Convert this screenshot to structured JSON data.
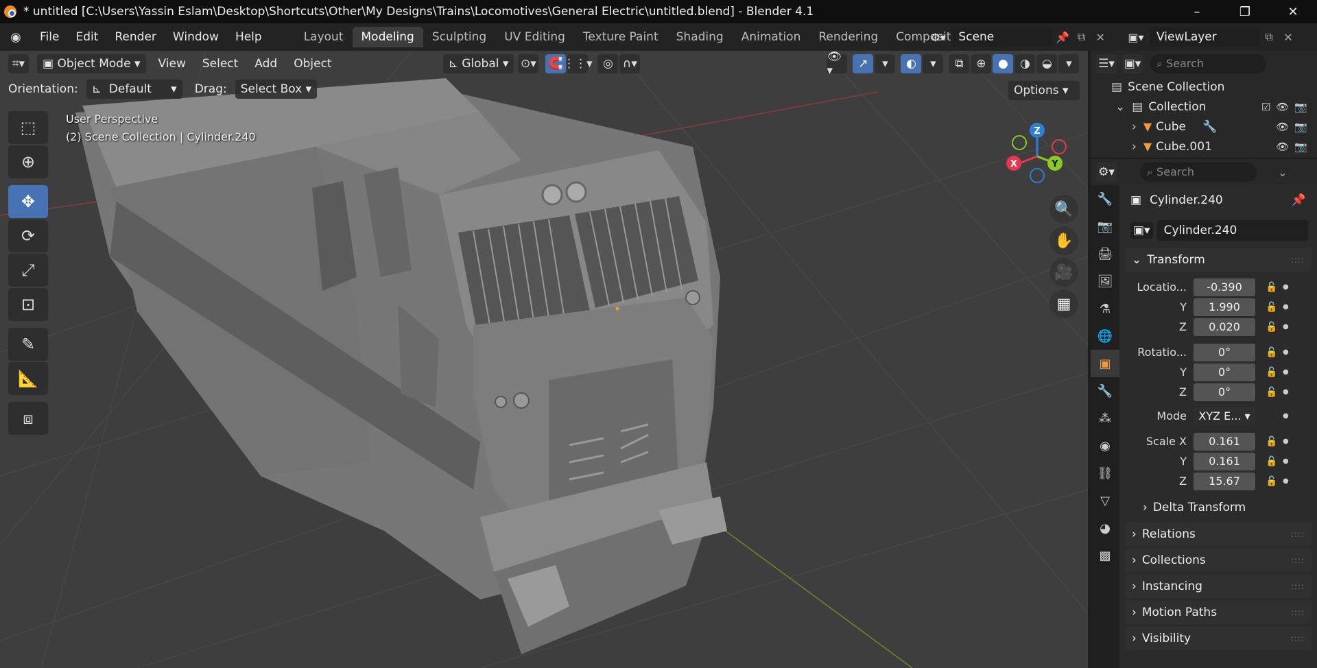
{
  "window": {
    "title": "* untitled [C:\\Users\\Yassin Eslam\\Desktop\\Shortcuts\\Other\\My Designs\\Trains\\Locomotives\\General Electric\\untitled.blend] - Blender 4.1",
    "minimize": "–",
    "maximize": "❐",
    "close": "✕"
  },
  "menu": {
    "items": [
      "File",
      "Edit",
      "Render",
      "Window",
      "Help"
    ],
    "workspaces": [
      "Layout",
      "Modeling",
      "Sculpting",
      "UV Editing",
      "Texture Paint",
      "Shading",
      "Animation",
      "Rendering",
      "Compositin"
    ],
    "active_workspace": "Modeling",
    "scene": "Scene",
    "view_layer": "ViewLayer"
  },
  "viewport": {
    "mode": "Object Mode",
    "menus": [
      "View",
      "Select",
      "Add",
      "Object"
    ],
    "transform_orientation": "Global",
    "orientation_label": "Orientation:",
    "orientation_value": "Default",
    "drag_label": "Drag:",
    "drag_value": "Select Box",
    "options_label": "Options",
    "perspective_text": "User Perspective",
    "collection_text": "(2) Scene Collection | Cylinder.240",
    "gizmo": {
      "x": "X",
      "y": "Y",
      "z": "Z"
    }
  },
  "tools": [
    "select-box",
    "cursor",
    "move",
    "rotate",
    "scale",
    "transform",
    "annotate",
    "measure",
    "add-cube"
  ],
  "outliner": {
    "search_placeholder": "Search",
    "rows": [
      {
        "label": "Scene Collection"
      },
      {
        "label": "Collection"
      },
      {
        "label": "Cube"
      },
      {
        "label": "Cube.001"
      }
    ]
  },
  "properties": {
    "search_placeholder": "Search",
    "object_name": "Cylinder.240",
    "data_name": "Cylinder.240",
    "transform_title": "Transform",
    "location": {
      "label": "Locatio...",
      "x": "-0.390",
      "y": "1.990",
      "z": "0.020"
    },
    "rotation": {
      "label": "Rotatio...",
      "x": "0°",
      "y": "0°",
      "z": "0°"
    },
    "mode_label": "Mode",
    "mode_value": "XYZ E...",
    "scale": {
      "label": "Scale X",
      "x": "0.161",
      "y": "0.161",
      "z": "15.67"
    },
    "axis_y": "Y",
    "axis_z": "Z",
    "delta_transform": "Delta Transform",
    "panels": [
      "Relations",
      "Collections",
      "Instancing",
      "Motion Paths",
      "Visibility"
    ]
  },
  "colors": {
    "accent": "#4772b3",
    "object_orange": "#f09a3a",
    "axis_x": "#e8364e",
    "axis_y": "#8ac926",
    "axis_z": "#2e7fd6"
  }
}
